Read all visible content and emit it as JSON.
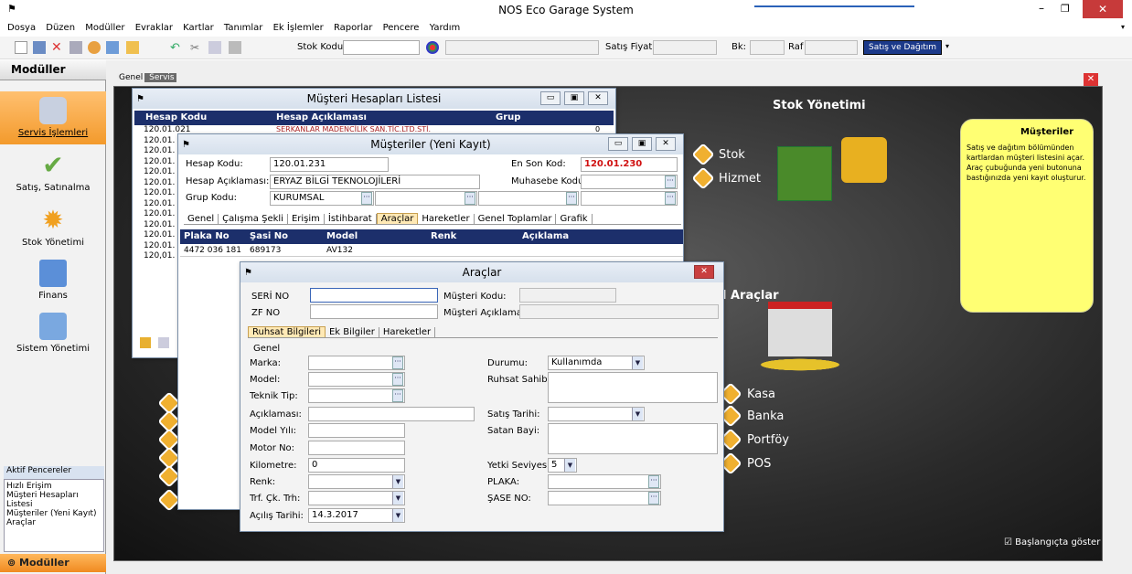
{
  "title": "NOS Eco Garage System",
  "menu": [
    "Dosya",
    "Düzen",
    "Modüller",
    "Evraklar",
    "Kartlar",
    "Tanımlar",
    "Ek İşlemler",
    "Raporlar",
    "Pencere",
    "Yardım"
  ],
  "toolbar": {
    "stok_kodu": "Stok Kodu",
    "satis_fiyati": "Satış Fiyatı",
    "bk": "Bk:",
    "raf": "Raf",
    "satis_dagitim": "Satış ve Dağıtım"
  },
  "sidebar": {
    "header": "Modüller",
    "items": [
      "Servis İşlemleri",
      "Satış, Satınalma",
      "Stok Yönetimi",
      "Finans",
      "Sistem Yönetimi"
    ],
    "aktif_header": "Aktif Pencereler",
    "aktif": [
      "Hızlı Erişim",
      "Müşteri Hesapları Listesi",
      "Müşteriler (Yeni Kayıt)",
      "Araçlar"
    ],
    "footer": "Modüller"
  },
  "main_tabs": [
    "Genel",
    "Servis"
  ],
  "panel": {
    "stok_title": "Stok Yönetimi",
    "stok": "Stok",
    "hizmet": "Hizmet",
    "araclar_title": "l Araçlar",
    "kasa": "Kasa",
    "banka": "Banka",
    "portfoy": "Portföy",
    "pos": "POS",
    "baslangic": "Başlangıçta göster",
    "note_title": "Müşteriler",
    "note_text": "Satış ve dağıtım bölümünden kartlardan müşteri listesini açar. Araç çubuğunda yeni butonuna bastığınızda yeni kayıt oluşturur."
  },
  "musteri_list": {
    "title": "Müşteri Hesapları Listesi",
    "cols": [
      "Hesap Kodu",
      "Hesap Açıklaması",
      "Grup"
    ],
    "rows": [
      "120.01.021",
      "120.01.",
      "120.01.",
      "120.01.",
      "120.01.",
      "120.01.",
      "120.01.",
      "120.01.",
      "120.01.",
      "120.01.",
      "120.01.",
      "120.01.",
      "120,01."
    ],
    "first_desc": "SERKANLAR MADENCİLİK SAN.TİC.LTD.STİ.",
    "first_grp": "0"
  },
  "musteri_form": {
    "title": "Müşteriler (Yeni Kayıt)",
    "hesap_kodu_lbl": "Hesap Kodu:",
    "hesap_kodu": "120.01.231",
    "en_son_lbl": "En Son Kod:",
    "en_son": "120.01.230",
    "hesap_ack_lbl": "Hesap Açıklaması:",
    "hesap_ack": "ERYAZ BİLGİ TEKNOLOJİLERİ",
    "muhasebe_lbl": "Muhasebe Kodu:",
    "grup_lbl": "Grup Kodu:",
    "grup": "KURUMSAL",
    "tabs": [
      "Genel",
      "Çalışma Şekli",
      "Erişim",
      "İstihbarat",
      "Araçlar",
      "Hareketler",
      "Genel Toplamlar",
      "Grafik"
    ],
    "grid_cols": [
      "Plaka No",
      "Şasi No",
      "Model",
      "Renk",
      "Açıklama"
    ],
    "grid_row": [
      "4472 036 181",
      "689173",
      "AV132",
      "",
      ""
    ]
  },
  "araclar": {
    "title": "Araçlar",
    "seri_lbl": "SERİ NO",
    "zf_lbl": "ZF NO",
    "mus_kod_lbl": "Müşteri Kodu:",
    "mus_ack_lbl": "Müşteri Açıklaması:",
    "tabs": [
      "Ruhsat Bilgileri",
      "Ek Bilgiler",
      "Hareketler"
    ],
    "genel": "Genel",
    "left_labels": [
      "Marka:",
      "Model:",
      "Teknik Tip:",
      "Açıklaması:",
      "Model Yılı:",
      "Motor No:",
      "Kilometre:",
      "Renk:",
      "Trf. Çk. Trh:",
      "Açılış Tarihi:"
    ],
    "kilometre": "0",
    "acilis": "14.3.2017",
    "durum_lbl": "Durumu:",
    "durum": "Kullanımda",
    "ruhsat_lbl": "Ruhsat Sahibi:",
    "satis_tarihi_lbl": "Satış Tarihi:",
    "satan_bayi_lbl": "Satan Bayi:",
    "yetki_lbl": "Yetki Seviyesi:",
    "yetki": "5",
    "plaka_lbl": "PLAKA:",
    "sase_lbl": "ŞASE NO:"
  }
}
